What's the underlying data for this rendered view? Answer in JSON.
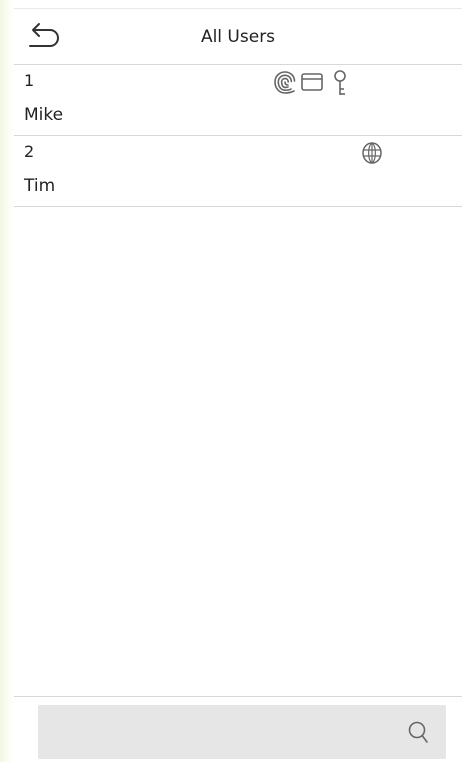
{
  "header": {
    "title": "All Users",
    "back_icon": "back-arrow-icon"
  },
  "users": [
    {
      "id": "1",
      "name": "Mike",
      "credentials": [
        "fingerprint-icon",
        "card-icon",
        "password-key-icon"
      ]
    },
    {
      "id": "2",
      "name": "Tim",
      "credentials": [
        "face-icon"
      ]
    }
  ],
  "search": {
    "icon": "search-icon"
  },
  "colors": {
    "icon_gray": "#666666",
    "divider": "#d8d8d8",
    "search_bg": "#e6e6e6",
    "text": "#222222",
    "edge_glow": "#f2f7e2"
  }
}
